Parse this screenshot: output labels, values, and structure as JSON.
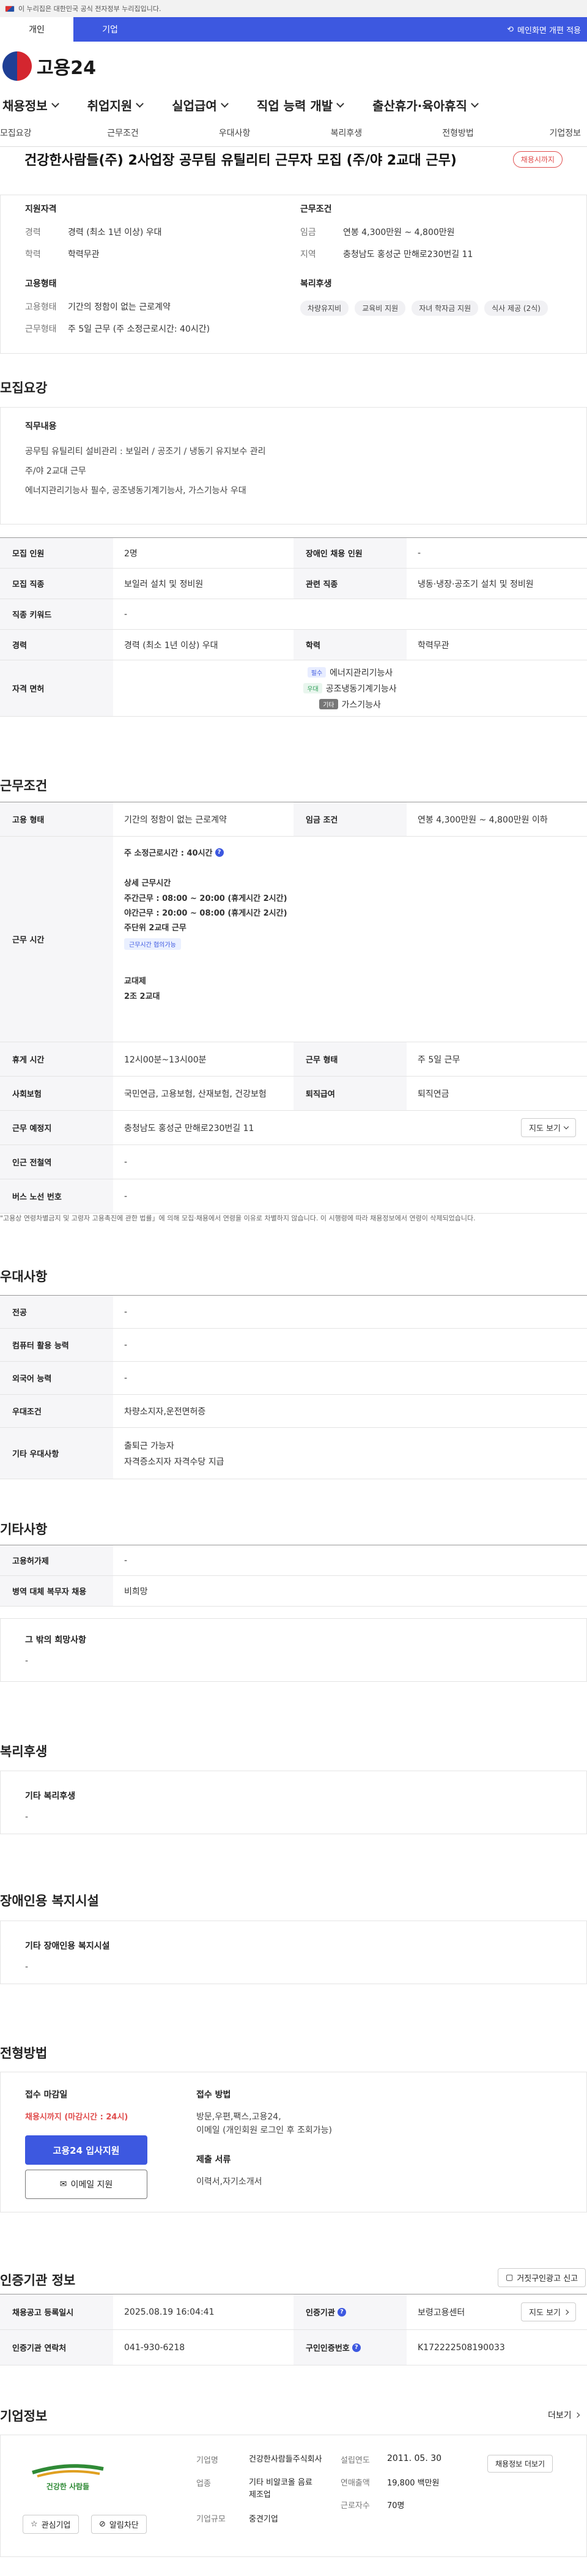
{
  "gov_bar": {
    "text": "이 누리집은 대한민국 공식 전자정부 누리집입니다."
  },
  "top_tabs": [
    {
      "label": "개인"
    },
    {
      "label": "기업"
    }
  ],
  "top_right": {
    "label": "메인화면 개편 적용"
  },
  "logo": {
    "text": "고용24"
  },
  "gnb": [
    {
      "label": "채용정보"
    },
    {
      "label": "취업지원"
    },
    {
      "label": "실업급여"
    },
    {
      "label": "직업 능력 개발"
    },
    {
      "label": "출산휴가·육아휴직"
    }
  ],
  "subnav": [
    {
      "label": "모집요강"
    },
    {
      "label": "근무조건"
    },
    {
      "label": "우대사항"
    },
    {
      "label": "복리후생"
    },
    {
      "label": "전형방법"
    },
    {
      "label": "기업정보"
    }
  ],
  "job": {
    "title": "건강한사람들(주) 2사업장 공무팀 유틸리티 근무자 모집 (주/야 2교대 근무)",
    "status": "채용시까지"
  },
  "summary": {
    "qual_h": "지원자격",
    "qual": [
      {
        "k": "경력",
        "v": "경력 (최소 1년 이상) 우대"
      },
      {
        "k": "학력",
        "v": "학력무관"
      }
    ],
    "emp_h": "고용형태",
    "emp": [
      {
        "k": "고용형태",
        "v": "기간의 정함이 없는 근로계약"
      },
      {
        "k": "근무형태",
        "v": "주 5일 근무 (주 소정근로시간: 40시간)"
      }
    ],
    "cond_h": "근무조건",
    "cond": [
      {
        "k": "임금",
        "v": "연봉 4,300만원 ~ 4,800만원"
      },
      {
        "k": "지역",
        "v": "충청남도 홍성군 만해로230번길 11"
      }
    ],
    "welfare_h": "복리후생",
    "welfare": [
      "차량유지비",
      "교육비 지원",
      "자녀 학자금 지원",
      "식사 제공 (2식)"
    ]
  },
  "recruit": {
    "title": "모집요강",
    "duty_h": "직무내용",
    "duty": [
      "공무팀 유틸리티 설비관리 : 보일러 / 공조기 / 냉동기 유지보수 관리",
      "주/야 2교대 근무",
      "에너지관리기능사 필수, 공조냉동기계기능사,  가스기능사 우대"
    ],
    "rows": {
      "count_k": "모집 인원",
      "count_v": "2명",
      "dis_k": "장애인 채용 인원",
      "dis_v": "-",
      "job_k": "모집 직종",
      "job_v": "보일러 설치 및 정비원",
      "rel_k": "관련 직종",
      "rel_v": "냉동·냉장·공조기 설치 및 정비원",
      "kw_k": "직종 키워드",
      "kw_v": "-",
      "career_k": "경력",
      "career_v": "경력 (최소 1년 이상) 우대",
      "edu_k": "학력",
      "edu_v": "학력무관",
      "lic_k": "자격 면허",
      "lic": [
        {
          "badge": "필수",
          "name": "에너지관리기능사"
        },
        {
          "badge": "우대",
          "name": "공조냉동기계기능사"
        },
        {
          "badge": "기타",
          "name": "가스기능사"
        }
      ]
    }
  },
  "work": {
    "title": "근무조건",
    "type_k": "고용 형태",
    "type_v": "기간의 정함이 없는 근로계약",
    "wage_k": "임금 조건",
    "wage_v": "연봉 4,300만원 ~ 4,800만원 이하",
    "time_k": "근무 시간",
    "time_main": "주 소정근로시간 : 40시간",
    "time_detail_h": "상세 근무시간",
    "time_lines": [
      "주간근무 : 08:00 ~ 20:00 (휴게시간 2시간)",
      "야간근무 : 20:00 ~ 08:00 (휴게시간 2시간)",
      "주단위 2교대 근무"
    ],
    "time_chip": "근무시간 협의가능",
    "shift_h": "교대제",
    "shift_v": "2조 2교대",
    "rest_k": "휴게 시간",
    "rest_v": "12시00분~13시00분",
    "form_k": "근무 형태",
    "form_v": "주 5일 근무",
    "ins_k": "사회보험",
    "ins_v": "국민연금, 고용보험, 산재보험, 건강보험",
    "ret_k": "퇴직급여",
    "ret_v": "퇴직연금",
    "place_k": "근무 예정지",
    "place_v": "충청남도 홍성군 만해로230번길 11",
    "map_btn": "지도 보기",
    "sub_k": "인근 전철역",
    "sub_v": "-",
    "bus_k": "버스 노선 번호",
    "bus_v": "-",
    "note": "\"고용상 연령차별금지 및 고령자 고용촉진에 관한 법률」에 의해 모집·채용에서 연령을 이유로 차별하지 않습니다. 이 시행령에 따라 채용정보에서 연령이 삭제되었습니다."
  },
  "pref": {
    "title": "우대사항",
    "rows": [
      {
        "k": "전공",
        "v": "-"
      },
      {
        "k": "컴퓨터 활용 능력",
        "v": "-"
      },
      {
        "k": "외국어 능력",
        "v": "-"
      },
      {
        "k": "우대조건",
        "v": "차량소지자,운전면허증"
      }
    ],
    "etc_k": "기타 우대사항",
    "etc_v": [
      "출퇴근 가능자",
      "자격증소지자 자격수당 지급"
    ]
  },
  "other": {
    "title": "기타사항",
    "rows": [
      {
        "k": "고용허가제",
        "v": "-"
      },
      {
        "k": "병역 대체 복무자 채용",
        "v": "비희망"
      }
    ],
    "wish_h": "그 밖의 희망사항",
    "wish_v": "-"
  },
  "benefit": {
    "title": "복리후생",
    "h": "기타 복리후생",
    "v": "-"
  },
  "disab": {
    "title": "장애인용 복지시설",
    "h": "기타 장애인용 복지시설",
    "v": "-"
  },
  "apply": {
    "title": "전형방법",
    "deadline_h": "접수 마감일",
    "deadline_v": "채용시까지 (마감시간 : 24시)",
    "apply_btn": "고용24 입사지원",
    "email_btn": "이메일 지원",
    "method_h": "접수 방법",
    "method_v": [
      "방문,우편,팩스,고용24,",
      "이메일 (개인회원 로그인 후 조회가능)"
    ],
    "docs_h": "제출 서류",
    "docs_v": "이력서,자기소개서"
  },
  "agency": {
    "title": "인증기관 정보",
    "report_btn": "거짓구인광고 신고",
    "reg_k": "채용공고 등록일시",
    "reg_v": "2025.08.19 16:04:41",
    "agency_k": "인증기관",
    "agency_v": "보령고용센터",
    "map_btn": "지도 보기",
    "tel_k": "인증기관 연락처",
    "tel_v": "041-930-6218",
    "no_k": "구인인증번호",
    "no_v": "K172222508190033"
  },
  "company": {
    "title": "기업정보",
    "more": "더보기",
    "logo_text": "건강한 사람들",
    "fav_btn": "관심기업",
    "alert_btn": "알림차단",
    "name_k": "기업명",
    "name_v": "건강한사람들주식회사",
    "ind_k": "업종",
    "ind_v": "기타 비알코올 음료 제조업",
    "size_k": "기업규모",
    "size_v": "중견기업",
    "est_k": "설립연도",
    "est_v": "2011. 05. 30",
    "sales_k": "연매출액",
    "sales_v": "19,800 백만원",
    "emp_k": "근로자수",
    "emp_v": "70명",
    "jobs_btn": "채용정보 더보기"
  }
}
